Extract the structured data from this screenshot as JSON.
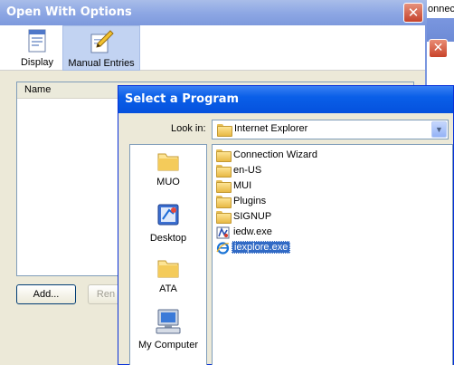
{
  "background_window": {
    "title_fragment": "onnect"
  },
  "main_window": {
    "title": "Open With Options",
    "close_glyph": "✕",
    "toolbar": [
      {
        "label": "Display",
        "icon": "window-icon",
        "selected": false
      },
      {
        "label": "Manual Entries",
        "icon": "pencil-icon",
        "selected": true
      }
    ],
    "list_header": "Name",
    "add_button": "Add...",
    "remove_button_fragment": "Ren"
  },
  "dialog": {
    "title": "Select a Program",
    "look_in_label": "Look in:",
    "look_in_value": "Internet Explorer",
    "places": [
      {
        "label": "MUO",
        "icon": "folder-icon"
      },
      {
        "label": "Desktop",
        "icon": "desktop-icon"
      },
      {
        "label": "ATA",
        "icon": "folder-icon"
      },
      {
        "label": "My Computer",
        "icon": "computer-icon"
      }
    ],
    "files": [
      {
        "name": "Connection Wizard",
        "icon": "folder-icon",
        "selected": false
      },
      {
        "name": "en-US",
        "icon": "folder-icon",
        "selected": false
      },
      {
        "name": "MUI",
        "icon": "folder-icon",
        "selected": false
      },
      {
        "name": "Plugins",
        "icon": "folder-icon",
        "selected": false
      },
      {
        "name": "SIGNUP",
        "icon": "folder-icon",
        "selected": false
      },
      {
        "name": "iedw.exe",
        "icon": "iedw-exe-icon",
        "selected": false
      },
      {
        "name": "iexplore.exe",
        "icon": "internet-explorer-icon",
        "selected": true
      }
    ]
  },
  "colors": {
    "xp_blue_title": "#0a5fe8",
    "inactive_title": "#8ea8e4",
    "selection": "#316ac5",
    "close_red": "#c5432c"
  }
}
